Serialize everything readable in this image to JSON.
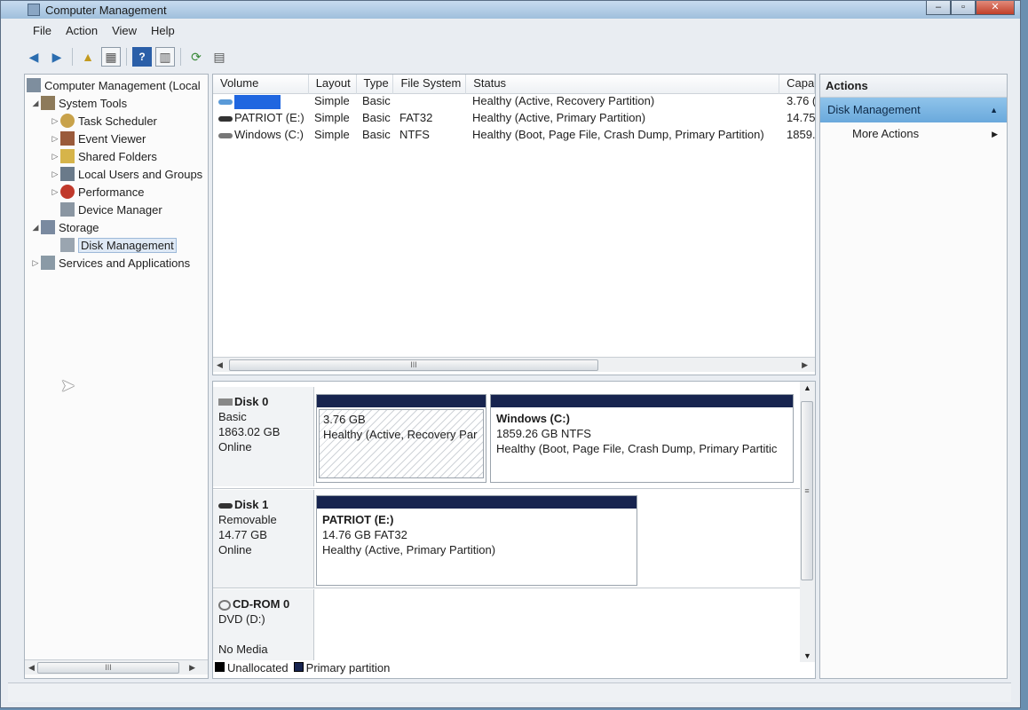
{
  "window": {
    "title": "Computer Management",
    "buttons": [
      "–",
      "▫",
      "✕"
    ]
  },
  "menu": [
    "File",
    "Action",
    "View",
    "Help"
  ],
  "toolbar_icons": [
    "back-arrow-icon",
    "forward-arrow-icon",
    "up-folder-icon",
    "show-hide-console-tree-icon",
    "help-icon",
    "show-hide-action-pane-icon",
    "refresh-icon",
    "properties-icon"
  ],
  "tree": {
    "root": "Computer Management (Local",
    "items": [
      {
        "label": "System Tools",
        "level": 1,
        "expander": "◢"
      },
      {
        "label": "Task Scheduler",
        "level": 2,
        "expander": "▷"
      },
      {
        "label": "Event Viewer",
        "level": 2,
        "expander": "▷"
      },
      {
        "label": "Shared Folders",
        "level": 2,
        "expander": "▷"
      },
      {
        "label": "Local Users and Groups",
        "level": 2,
        "expander": "▷"
      },
      {
        "label": "Performance",
        "level": 2,
        "expander": "▷"
      },
      {
        "label": "Device Manager",
        "level": 2,
        "expander": ""
      },
      {
        "label": "Storage",
        "level": 1,
        "expander": "◢"
      },
      {
        "label": "Disk Management",
        "level": 2,
        "expander": "",
        "selected": true
      },
      {
        "label": "Services and Applications",
        "level": 1,
        "expander": "▷"
      }
    ],
    "scroll_thumb": "III"
  },
  "volumes": {
    "columns": [
      "Volume",
      "Layout",
      "Type",
      "File System",
      "Status",
      "Capa"
    ],
    "rows": [
      {
        "volume": "",
        "redacted": true,
        "layout": "Simple",
        "type": "Basic",
        "fs": "",
        "status": "Healthy (Active, Recovery Partition)",
        "capacity": "3.76 ("
      },
      {
        "volume": "PATRIOT (E:)",
        "redacted": false,
        "layout": "Simple",
        "type": "Basic",
        "fs": "FAT32",
        "status": "Healthy (Active, Primary Partition)",
        "capacity": "14.75"
      },
      {
        "volume": "Windows (C:)",
        "redacted": false,
        "layout": "Simple",
        "type": "Basic",
        "fs": "NTFS",
        "status": "Healthy (Boot, Page File, Crash Dump, Primary Partition)",
        "capacity": "1859."
      }
    ],
    "scroll_thumb": "III"
  },
  "disks": [
    {
      "name": "Disk 0",
      "kind": "Basic",
      "size": "1863.02 GB",
      "state": "Online",
      "partitions": [
        {
          "name": "",
          "size": "3.76 GB",
          "status": "Healthy (Active, Recovery Par"
        },
        {
          "name": "Windows  (C:)",
          "size": "1859.26 GB NTFS",
          "status": "Healthy (Boot, Page File, Crash Dump, Primary Partitic"
        }
      ]
    },
    {
      "name": "Disk 1",
      "kind": "Removable",
      "size": "14.77 GB",
      "state": "Online",
      "partitions": [
        {
          "name": "PATRIOT  (E:)",
          "size": "14.76 GB FAT32",
          "status": "Healthy (Active, Primary Partition)"
        }
      ]
    },
    {
      "name": "CD-ROM 0",
      "kind": "DVD (D:)",
      "size": "",
      "state": "No Media",
      "partitions": []
    }
  ],
  "legend": [
    {
      "label": "Unallocated",
      "color": "#000000"
    },
    {
      "label": "Primary partition",
      "color": "#17244f"
    }
  ],
  "actions": {
    "header": "Actions",
    "section": "Disk Management",
    "items": [
      "More Actions"
    ]
  }
}
